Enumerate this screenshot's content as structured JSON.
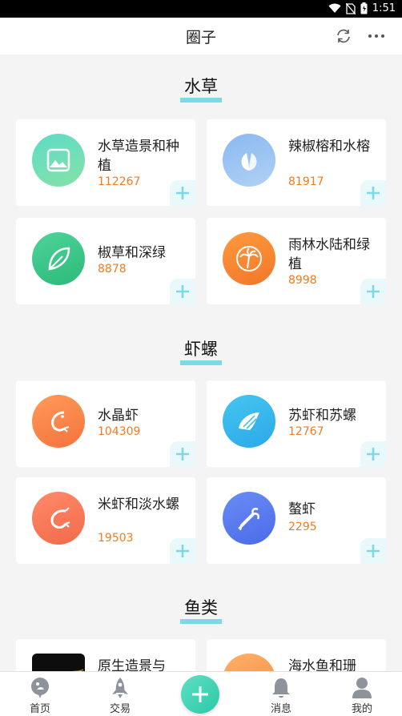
{
  "status_bar": {
    "time": "1:51"
  },
  "header": {
    "title": "圈子"
  },
  "sections": [
    {
      "title": "水草"
    },
    {
      "title": "虾螺"
    },
    {
      "title": "鱼类"
    }
  ],
  "cards": [
    {
      "name": "水草造景和种植",
      "count": "112267",
      "icon": "landscape-picture-icon"
    },
    {
      "name": "辣椒榕和水榕",
      "count": "81917",
      "icon": "leaves-icon"
    },
    {
      "name": "椒草和深绿",
      "count": "8878",
      "icon": "leaf-icon"
    },
    {
      "name": "雨林水陆和绿植",
      "count": "8998",
      "icon": "palm-tree-icon"
    },
    {
      "name": "水晶虾",
      "count": "104309",
      "icon": "shrimp-icon"
    },
    {
      "name": "苏虾和苏螺",
      "count": "12767",
      "icon": "seashell-icon"
    },
    {
      "name": "米虾和淡水螺",
      "count": "19503",
      "icon": "shrimp-icon"
    },
    {
      "name": "螯虾",
      "count": "2295",
      "icon": "crayfish-icon"
    },
    {
      "name": "原生造景与",
      "count": "",
      "icon": "photo-thumbnail"
    },
    {
      "name": "海水鱼和珊",
      "count": "",
      "icon": "fish-icon"
    }
  ],
  "bottom_nav": {
    "home": "首页",
    "trade": "交易",
    "messages": "消息",
    "mine": "我的"
  },
  "colors": {
    "accent": "#7fd8e6",
    "count": "#f27b1f",
    "plus": "#2cc8a6"
  }
}
